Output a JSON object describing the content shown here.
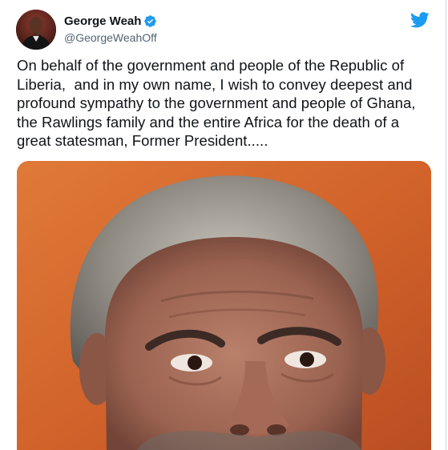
{
  "author": {
    "display_name": "George Weah",
    "handle": "@GeorgeWeahOff",
    "verified": true
  },
  "tweet": {
    "text": "On behalf of the government and people of the Republic of Liberia,  and in my own name, I wish to convey deepest and profound sympathy to the government and people of Ghana, the Rawlings family and the entire Africa for the death of a great statesman, Former President....."
  },
  "icons": {
    "verified": "verified-badge-icon",
    "brand": "twitter-bird-icon"
  },
  "colors": {
    "brand": "#1d9bf0",
    "text_primary": "#0f1419",
    "text_secondary": "#536471",
    "photo_background": "#d46a2c"
  }
}
